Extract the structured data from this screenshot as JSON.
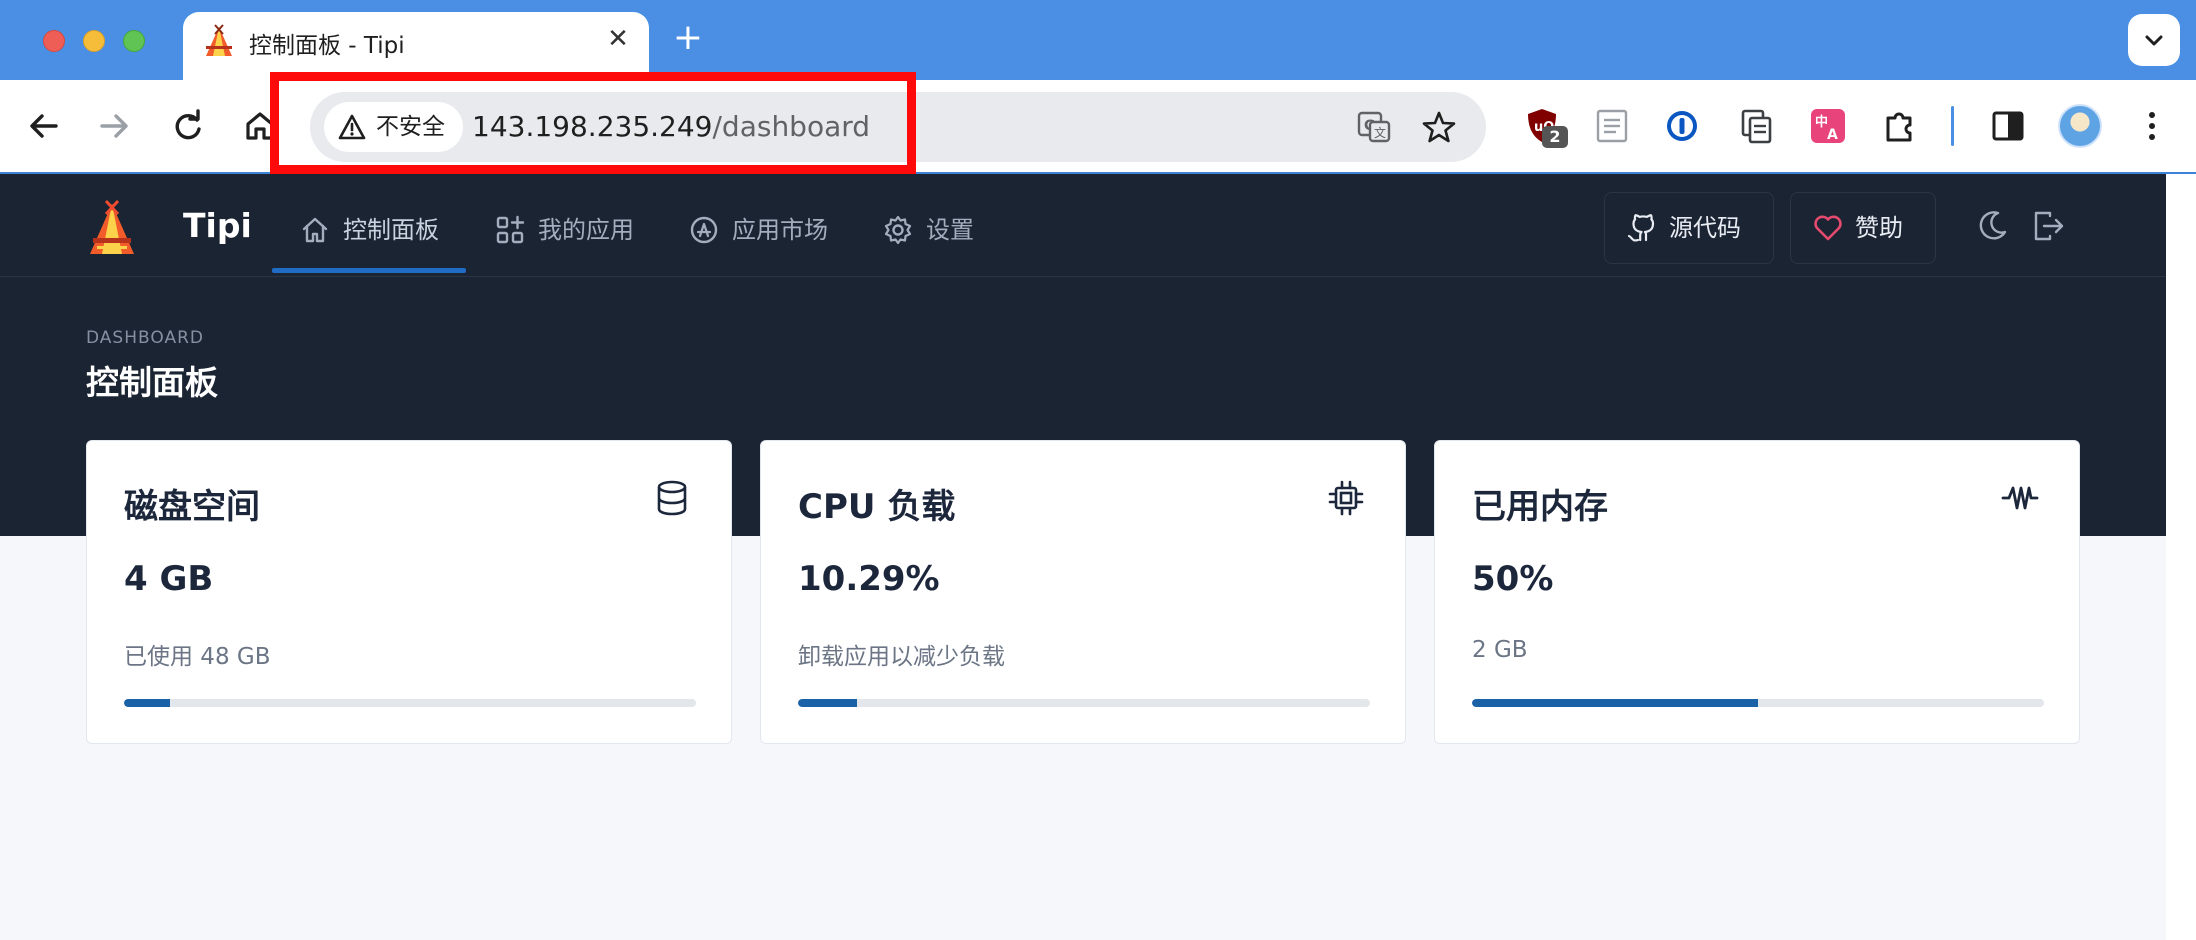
{
  "browser": {
    "tab": {
      "title": "控制面板 - Tipi",
      "close_glyph": "✕",
      "favicon": "tipi-logo-icon"
    },
    "new_tab_glyph": "+",
    "address": {
      "security_label": "不安全",
      "host": "143.198.235.249",
      "path": "/dashboard"
    },
    "extensions": [
      {
        "name": "ublock-origin-icon",
        "badge": "2"
      },
      {
        "name": "reader-mode-icon"
      },
      {
        "name": "1password-icon"
      },
      {
        "name": "clipboard-icon"
      },
      {
        "name": "translate-extension-icon"
      },
      {
        "name": "extensions-puzzle-icon"
      },
      {
        "name": "side-panel-icon"
      }
    ],
    "accent_color": "#4a8fe3",
    "highlight_color": "#ff0a0a"
  },
  "app": {
    "brand": "Tipi",
    "nav": [
      {
        "label": "控制面板",
        "icon": "home-icon",
        "active": true
      },
      {
        "label": "我的应用",
        "icon": "apps-grid-icon",
        "active": false
      },
      {
        "label": "应用市场",
        "icon": "app-store-icon",
        "active": false
      },
      {
        "label": "设置",
        "icon": "gear-icon",
        "active": false
      }
    ],
    "source_label": "源代码",
    "sponsor_label": "赞助",
    "pretitle": "DASHBOARD",
    "page_title": "控制面板",
    "cards": [
      {
        "title": "磁盘空间",
        "icon": "database-icon",
        "value": "4 GB",
        "subtitle": "已使用 48 GB",
        "progress": 0.08
      },
      {
        "title": "CPU 负载",
        "icon": "cpu-icon",
        "value": "10.29%",
        "subtitle": "卸载应用以减少负载",
        "progress": 0.1029
      },
      {
        "title": "已用内存",
        "icon": "activity-icon",
        "value": "50%",
        "subtitle": "2 GB",
        "progress": 0.5
      }
    ],
    "dark_bg": "#1b2433",
    "progress_color": "#1b61a8"
  }
}
